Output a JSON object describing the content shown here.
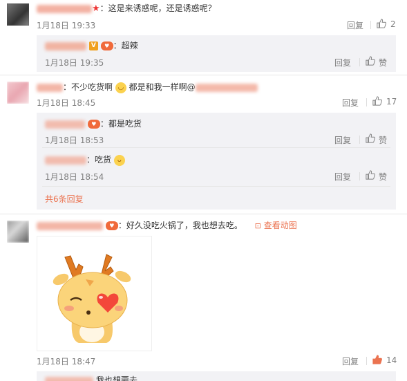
{
  "comments": [
    {
      "text": "：这是来诱惑呢，还是诱惑呢？",
      "time": "1月18日 19:33",
      "reply_label": "回复",
      "like_count": "2",
      "replies": [
        {
          "text": "：超辣",
          "time": "1月18日 19:35",
          "reply_label": "回复",
          "like_label": "赞"
        }
      ]
    },
    {
      "text_a": "：不少吃货啊",
      "text_b": " 都是和我一样啊@",
      "time": "1月18日 18:45",
      "reply_label": "回复",
      "like_count": "17",
      "replies": [
        {
          "text": "：都是吃货",
          "time": "1月18日 18:53",
          "reply_label": "回复",
          "like_label": "赞"
        },
        {
          "text": "：吃货",
          "time": "1月18日 18:54",
          "reply_label": "回复",
          "like_label": "赞"
        }
      ],
      "more_replies": "共6条回复"
    },
    {
      "text": "：好久没吃火锅了，我也想去吃。",
      "view_gif": "查看动图",
      "time": "1月18日 18:47",
      "reply_label": "回复",
      "like_count": "14",
      "replies": [
        {
          "text": "我也想要去"
        }
      ]
    }
  ],
  "colors": {
    "link": "#eb7350",
    "sub_bg": "#f2f2f5",
    "meta": "#808080",
    "like_active": "#eb7350"
  }
}
